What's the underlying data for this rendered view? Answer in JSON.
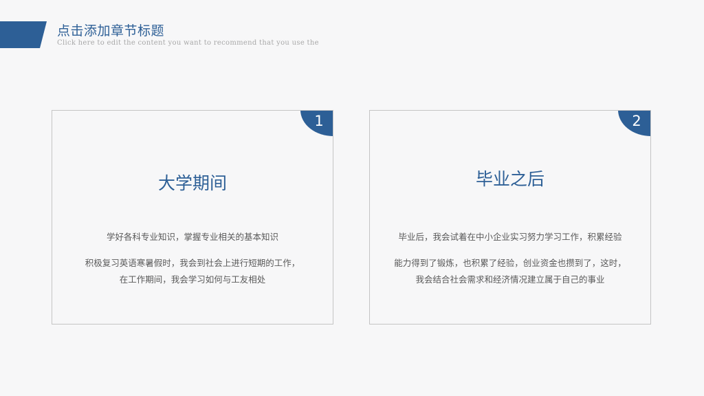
{
  "header": {
    "title": "点击添加章节标题",
    "subtitle": "Click here to edit the content you want to recommend that you use the",
    "accent_color": "#2d5f96"
  },
  "cards": [
    {
      "number": "1",
      "title": "大学期间",
      "line1": "学好各科专业知识，掌握专业相关的基本知识",
      "line2": "积极复习英语寒暑假时，我会到社会上进行短期的工作，",
      "line3": "在工作期间，我会学习如何与工友相处"
    },
    {
      "number": "2",
      "title": "毕业之后",
      "line1": "毕业后，我会试着在中小企业实习努力学习工作，积累经验",
      "line2": "能力得到了锻炼，也积累了经验，创业资金也攒到了，这时，",
      "line3": "我会结合社会需求和经济情况建立属于自己的事业"
    }
  ]
}
